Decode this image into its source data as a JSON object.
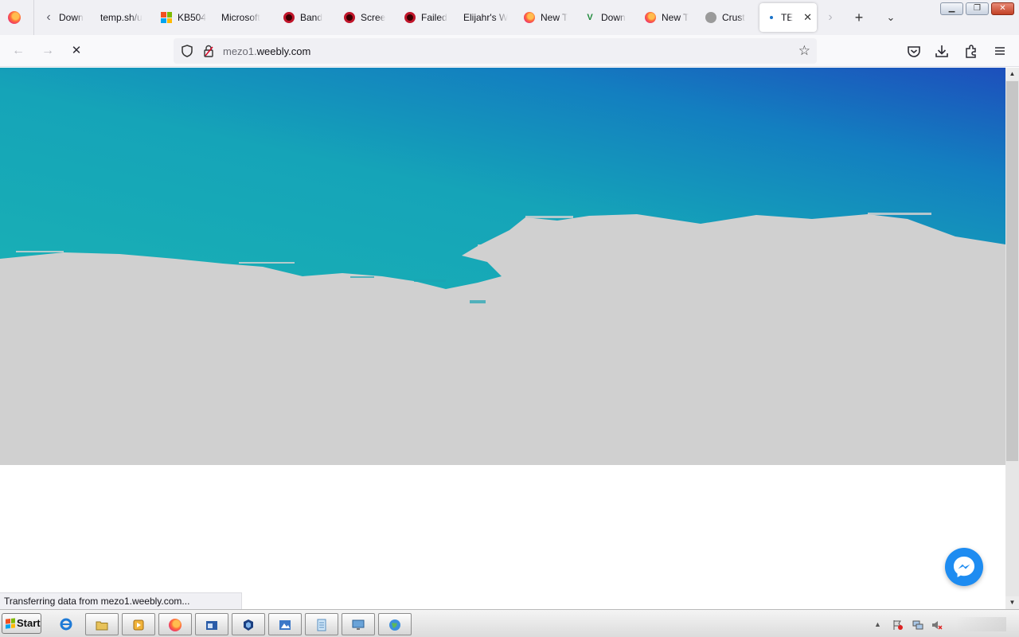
{
  "browser": {
    "tabs": [
      {
        "label": "Down",
        "icon": "back-arrow-icon"
      },
      {
        "label": "temp.sh/u",
        "icon": "none"
      },
      {
        "label": "KB504",
        "icon": "microsoft-logo-icon"
      },
      {
        "label": "Microsoft",
        "icon": "none"
      },
      {
        "label": "Band",
        "icon": "record-icon"
      },
      {
        "label": "Scree",
        "icon": "record-icon"
      },
      {
        "label": "Failed",
        "icon": "record-icon"
      },
      {
        "label": "Elijahr's W",
        "icon": "none"
      },
      {
        "label": "New T",
        "icon": "firefox-icon"
      },
      {
        "label": "Down",
        "icon": "vb-icon"
      },
      {
        "label": "New T",
        "icon": "firefox-icon"
      },
      {
        "label": "Crust",
        "icon": "shell-icon"
      },
      {
        "label": "TE",
        "icon": "loading-dot-icon",
        "active": true
      }
    ],
    "url_prefix": "mezo1.",
    "url_domain": "weebly.com",
    "status_text": "Transferring data from mezo1.weebly.com..."
  },
  "page": {
    "hero_colors": {
      "teal": "#16a8b6",
      "blue": "#1d55bb",
      "gray": "#d0d0d0"
    }
  },
  "taskbar": {
    "start_label": "Start"
  }
}
